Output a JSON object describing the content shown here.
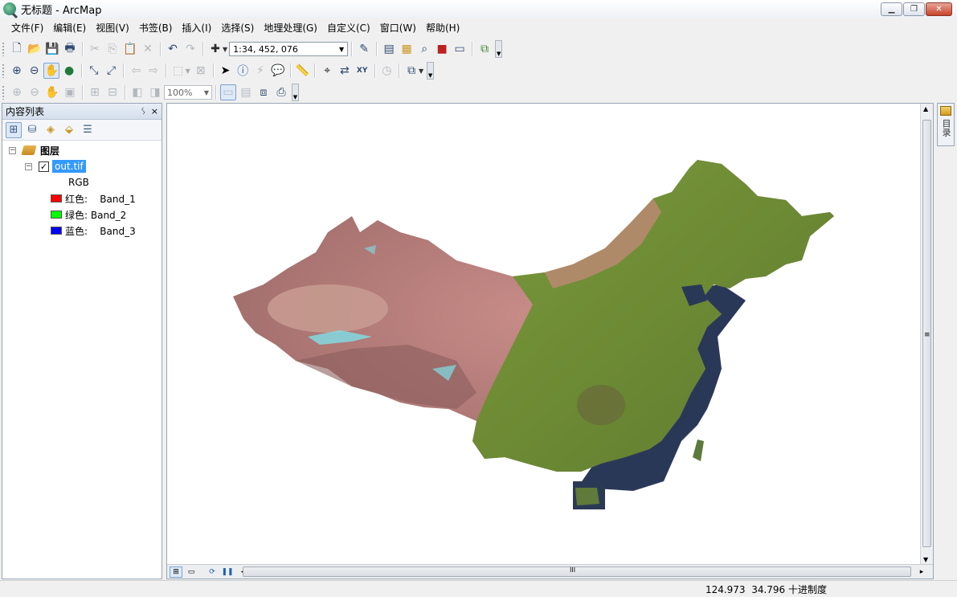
{
  "window": {
    "title": "无标题 - ArcMap"
  },
  "window_controls": {
    "minimize": "▁",
    "maximize": "❐",
    "close": "✕"
  },
  "menu": [
    "文件(F)",
    "编辑(E)",
    "视图(V)",
    "书签(B)",
    "插入(I)",
    "选择(S)",
    "地理处理(G)",
    "自定义(C)",
    "窗口(W)",
    "帮助(H)"
  ],
  "standard_toolbar": {
    "scale_value": "1:34, 452, 076"
  },
  "layout_toolbar": {
    "zoom_value": "100%"
  },
  "toc": {
    "title": "内容列表",
    "pin": "ᛊ",
    "close": "×",
    "root_layer": "图层",
    "layer": {
      "name": "out.tif",
      "checked": "✓",
      "renderer": "RGB",
      "bands": [
        {
          "label": "红色:    Band_1",
          "color": "#ff0000"
        },
        {
          "label": "绿色: Band_2",
          "color": "#00ff00"
        },
        {
          "label": "蓝色:    Band_3",
          "color": "#0000ff"
        }
      ]
    }
  },
  "map": {
    "raster": "out.tif",
    "hscroll_grip": "III",
    "vscroll_grip": "≡"
  },
  "right_dock": {
    "label": "目录"
  },
  "status": {
    "coords": "124.973  34.796 十进制度"
  },
  "icons": {
    "new": "new-document-icon",
    "open": "open-folder-icon",
    "save": "save-icon",
    "print": "print-icon",
    "cut": "cut-icon",
    "copy": "copy-icon",
    "paste": "paste-icon",
    "delete": "delete-icon",
    "undo": "undo-icon",
    "redo": "redo-icon",
    "add-data": "add-data-icon",
    "zoom-in": "zoom-in-icon",
    "zoom-out": "zoom-out-icon",
    "pan": "pan-hand-icon",
    "full-extent": "globe-icon",
    "identify": "identify-icon",
    "find": "binoculars-icon",
    "goto-xy": "goto-xy-icon"
  }
}
